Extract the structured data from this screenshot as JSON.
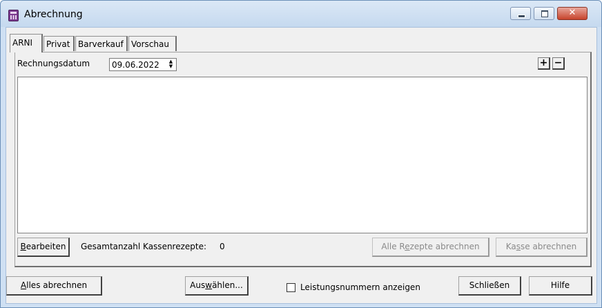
{
  "window": {
    "title": "Abrechnung",
    "controls": {
      "minimize": "–",
      "maximize": "□",
      "close": "✕"
    }
  },
  "tabs": [
    {
      "label": "ARNI",
      "active": true
    },
    {
      "label": "Privat",
      "active": false
    },
    {
      "label": "Barverkauf",
      "active": false
    },
    {
      "label": "Vorschau",
      "active": false
    }
  ],
  "panel": {
    "date_label": "Rechnungsdatum",
    "date_value": "09.06.2022",
    "plus_label": "+",
    "minus_label": "−",
    "edit_button": {
      "accel": "B",
      "rest": "earbeiten"
    },
    "count_label": "Gesamtanzahl Kassenrezepte:",
    "count_value": "0",
    "all_prescriptions_button": {
      "pre": "Alle R",
      "accel": "e",
      "post": "zepte abrechnen",
      "enabled": false
    },
    "cash_button": {
      "pre": "Ka",
      "accel": "s",
      "post": "se abrechnen",
      "enabled": false
    }
  },
  "footer": {
    "all_button": {
      "accel": "A",
      "rest": "lles abrechnen"
    },
    "select_button": {
      "pre": "Aus",
      "accel": "w",
      "post": "ählen..."
    },
    "service_numbers_checkbox": {
      "label": "Leistungsnummern anzeigen",
      "checked": false
    },
    "close_button": "Schließen",
    "help_button": "Hilfe"
  },
  "colors": {
    "frame": "#cfe0f3",
    "client": "#f0f0f0",
    "close_button": "#c7432c",
    "app_icon": "#7b3a8f"
  }
}
